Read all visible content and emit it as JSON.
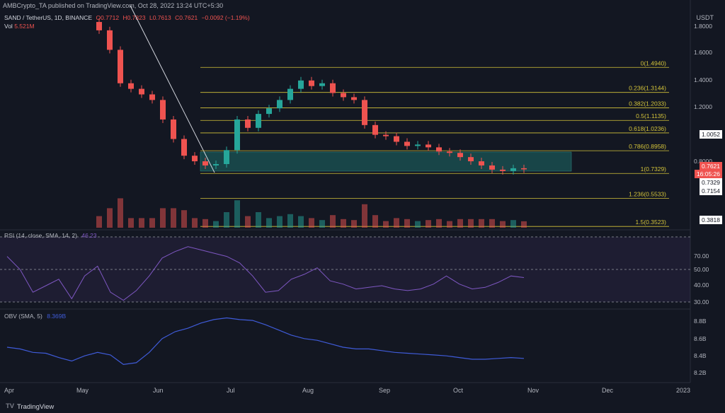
{
  "header": {
    "publisher": "AMBCrypto_TA published on TradingView.com, Oct 28, 2022 13:24 UTC+5:30",
    "symbol": "SAND / TetherUS, 1D, BINANCE",
    "ohlc": [
      "O0.7712",
      "H0.7823",
      "L0.7613",
      "C0.7621",
      "−0.0092 (−1.19%)"
    ],
    "vol_label": "Vol",
    "vol_value": "5.521M",
    "axis_unit": "USDT"
  },
  "price_axis": {
    "ticks": [
      "1.8000",
      "1.6000",
      "1.4000",
      "1.2000",
      "0.8000"
    ],
    "markers": {
      "current_price": "0.7621",
      "countdown": "16:05:26",
      "level_a": "1.0052",
      "level_b": "0.7329",
      "level_c": "0.7154",
      "level_d": "0.3818"
    }
  },
  "fib_levels": [
    {
      "label": "0(1.4940)",
      "price": 1.494
    },
    {
      "label": "0.236(1.3144)",
      "price": 1.3144
    },
    {
      "label": "0.382(1.2033)",
      "price": 1.2033
    },
    {
      "label": "0.5(1.1135)",
      "price": 1.1135
    },
    {
      "label": "0.618(1.0236)",
      "price": 1.0236
    },
    {
      "label": "0.786(0.8958)",
      "price": 0.8958
    },
    {
      "label": "1(0.7329)",
      "price": 0.7329
    },
    {
      "label": "1.236(0.5533)",
      "price": 0.5533
    },
    {
      "label": "1.5(0.3523)",
      "price": 0.3523
    }
  ],
  "rsi_pane": {
    "label": "RSI (14, close, SMA, 14, 2)",
    "ticks": [
      "70.00",
      "50.00",
      "40.00",
      "30.00"
    ],
    "current": "46.23"
  },
  "obv_pane": {
    "label": "OBV (SMA, 5)",
    "value": "8.369B",
    "ticks": [
      "8.8B",
      "8.6B",
      "8.4B",
      "8.2B"
    ]
  },
  "time_axis": [
    "Apr",
    "May",
    "Jun",
    "Jul",
    "Aug",
    "Sep",
    "Oct",
    "Nov",
    "Dec",
    "2023"
  ],
  "footer": {
    "brand": "TradingView",
    "logo": "TV"
  },
  "colors": {
    "bg": "#131722",
    "up": "#26a69a",
    "down": "#ef5350",
    "fib": "#d4c43a",
    "zone": "#1e6b68",
    "indicator": "#7e57c2",
    "obv": "#3f5bd8"
  },
  "chart_data": {
    "type": "candlestick",
    "price_yaxis_ticks": [
      1.8,
      1.6,
      1.4,
      1.2,
      0.8
    ],
    "closes_approx": [
      1.76,
      1.62,
      1.38,
      1.34,
      1.3,
      1.26,
      1.12,
      0.98,
      0.86,
      0.82,
      0.79,
      0.8,
      0.9,
      1.12,
      1.06,
      1.16,
      1.2,
      1.26,
      1.34,
      1.4,
      1.36,
      1.38,
      1.31,
      1.28,
      1.26,
      1.08,
      1.01,
      1.0,
      0.96,
      0.93,
      0.94,
      0.92,
      0.89,
      0.88,
      0.85,
      0.82,
      0.79,
      0.76,
      0.75,
      0.77,
      0.762
    ],
    "rsi_approx": [
      58,
      50,
      36,
      40,
      44,
      32,
      46,
      52,
      36,
      31,
      37,
      46,
      57,
      61,
      64,
      62,
      60,
      58,
      54,
      46,
      36,
      37,
      44,
      47,
      51,
      43,
      41,
      38,
      39,
      40,
      38,
      37,
      38,
      41,
      46,
      41,
      38,
      39,
      42,
      46,
      45
    ],
    "obv_approx": [
      8.52,
      8.5,
      8.46,
      8.45,
      8.4,
      8.36,
      8.42,
      8.46,
      8.43,
      8.32,
      8.34,
      8.46,
      8.62,
      8.7,
      8.74,
      8.8,
      8.84,
      8.86,
      8.84,
      8.83,
      8.78,
      8.72,
      8.66,
      8.62,
      8.6,
      8.56,
      8.52,
      8.5,
      8.5,
      8.48,
      8.46,
      8.45,
      8.44,
      8.43,
      8.42,
      8.4,
      8.38,
      8.38,
      8.39,
      8.4,
      8.39
    ]
  }
}
